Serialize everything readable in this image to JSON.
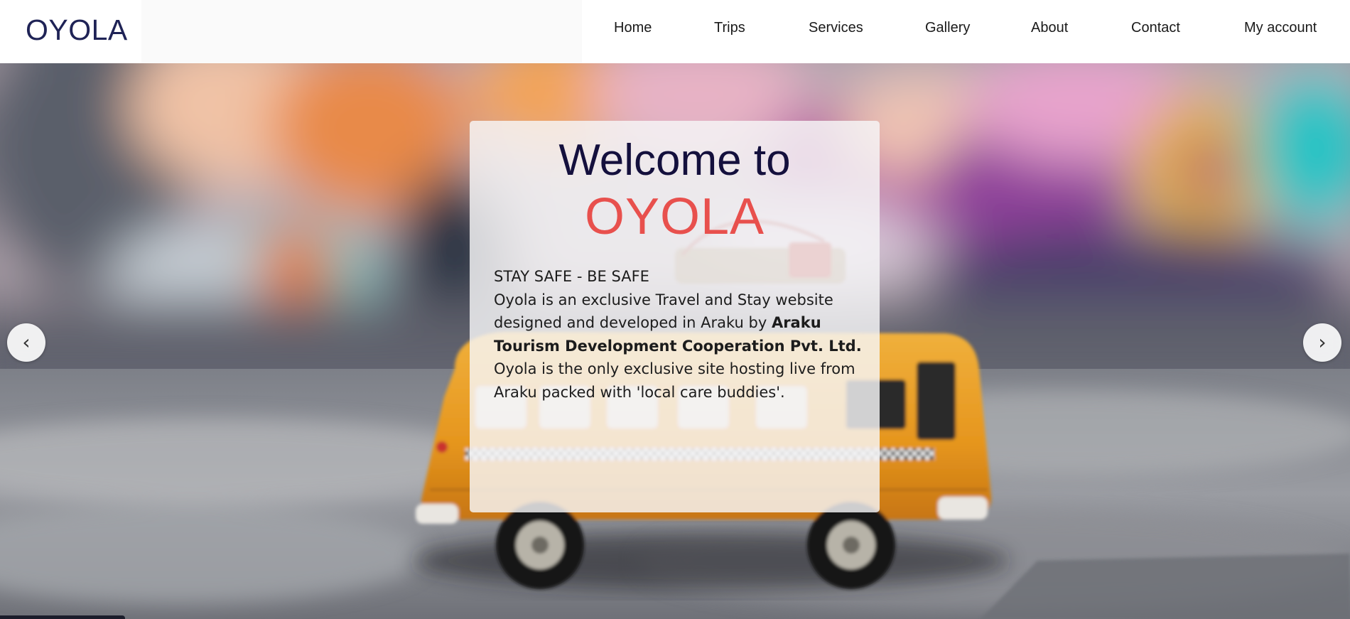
{
  "header": {
    "logo": "OYOLA",
    "nav": [
      {
        "label": "Home"
      },
      {
        "label": "Trips"
      },
      {
        "label": "Services"
      },
      {
        "label": "Gallery"
      },
      {
        "label": "About"
      },
      {
        "label": "Contact"
      },
      {
        "label": "My account"
      }
    ]
  },
  "hero": {
    "background": "blurred colorful wall with a yellow toy van on pavement",
    "card": {
      "title": "Welcome to",
      "brand": "OYOLA",
      "tagline": "STAY SAFE - BE SAFE",
      "text_1": "Oyola is an exclusive Travel and Stay website designed and developed in Araku by",
      "text_bold": "Araku Tourism Development Cooperation Pvt. Ltd.",
      "text_2": " Oyola is the only exclusive site hosting live from Araku packed with 'local care buddies'."
    },
    "prev_arrow": "‹",
    "next_arrow": "›",
    "prev_icon": "chevron-left-icon",
    "next_icon": "chevron-right-icon"
  },
  "colors": {
    "logo": "#1f2356",
    "title": "#14103d",
    "brand": "#e8504d",
    "van": "#e99a24"
  }
}
